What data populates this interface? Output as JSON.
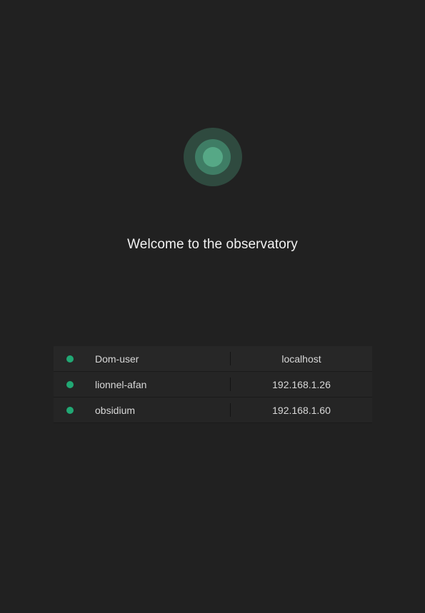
{
  "header": {
    "logo": "observatory-logo",
    "welcome_text": "Welcome to the observatory"
  },
  "colors": {
    "background": "#212121",
    "status_online": "#21a874",
    "logo_outer": "#2f4a3f",
    "logo_mid": "#3f7d65",
    "logo_inner": "#56a886"
  },
  "hosts": [
    {
      "name": "Dom-user",
      "address": "localhost",
      "status": "online"
    },
    {
      "name": "lionnel-afan",
      "address": "192.168.1.26",
      "status": "online"
    },
    {
      "name": "obsidium",
      "address": "192.168.1.60",
      "status": "online"
    }
  ]
}
